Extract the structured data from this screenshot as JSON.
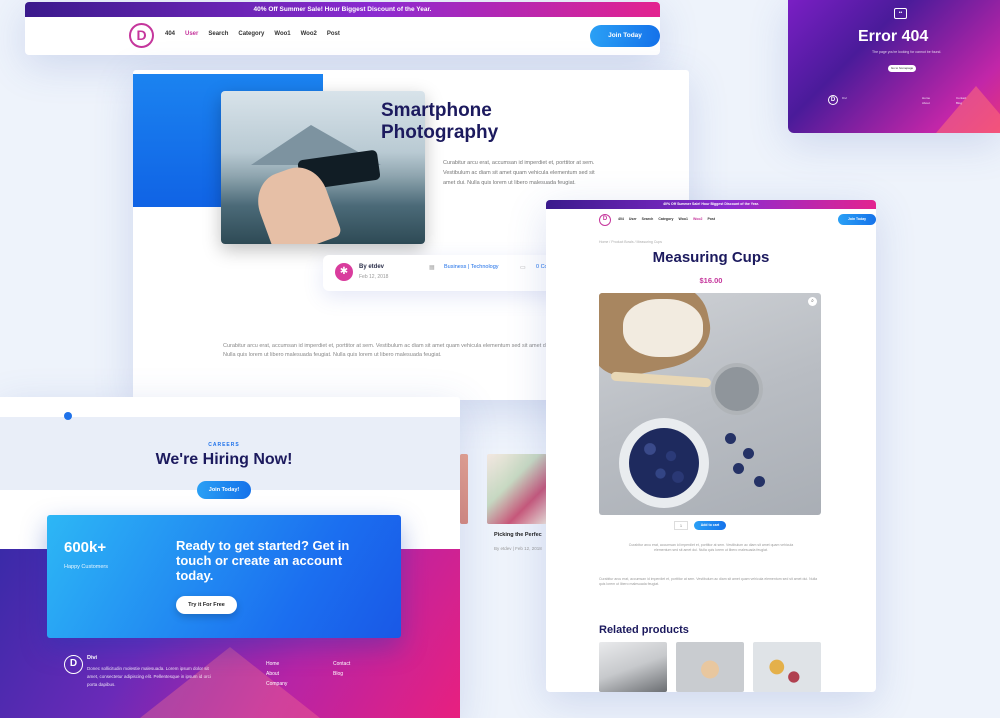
{
  "header": {
    "promo": "40% Off Summer Sale! Hour Biggest Discount of the Year.",
    "logo_letter": "D",
    "nav": [
      "404",
      "User",
      "Search",
      "Category",
      "Woo1",
      "Woo2",
      "Post"
    ],
    "active_nav": "User",
    "join_button": "Join Today",
    "accent_color": "#c5369c"
  },
  "error_page": {
    "title": "Error 404",
    "subtitle": "The page you're looking for cannot be found.",
    "button": "Go to homepage",
    "footer_brand": "Divi",
    "footer_links_1": [
      "Home",
      "About"
    ],
    "footer_links_2": [
      "Contact",
      "Blog"
    ]
  },
  "blog_post": {
    "title": "Smartphone Photography",
    "intro": "Curabitur arcu erat, accumsan id imperdiet et, porttitor at sem. Vestibulum ac diam sit amet quam vehicula elementum sed sit amet dui. Nulla quis lorem ut libero malesuada feugiat.",
    "author": "By etdev",
    "date": "Feb 12, 2018",
    "category": "Business | Technology",
    "comments": "0 Co",
    "body": "Curabitur arcu erat, accumsan id imperdiet et, porttitor at sem. Vestibulum ac diam sit amet quam vehicula elementum sed sit amet dui. Nulla quis lorem ut libero malesuada feugiat. Nulla quis lorem ut libero malesuada feugiat."
  },
  "careers": {
    "eyebrow": "CAREERS",
    "title": "We're Hiring Now!",
    "button": "Join Today!",
    "stat_value": "600k+",
    "stat_label": "Happy Customers",
    "cta_text": "Ready to get started? Get in touch or create an account today.",
    "cta_button": "Try it For Free",
    "footer_brand": "Divi",
    "footer_text": "Donec sollicitudin molestie malesuada. Lorem ipsum dolor sit amet, consectetur adipiscing elit. Pellentesque in ipsum id orci porta dapibus.",
    "footer_links_1": [
      "Home",
      "About",
      "Company"
    ],
    "footer_links_2": [
      "Contact",
      "Blog"
    ]
  },
  "related_post": {
    "title": "Picking the Perfec",
    "meta": "By etdev | Feb 12, 2018"
  },
  "product": {
    "promo": "40% Off Summer Sale! Hour Biggest Discount of the Year.",
    "logo_letter": "D",
    "nav": [
      "404",
      "User",
      "Search",
      "Category",
      "Woo1",
      "Woo2",
      "Post"
    ],
    "join_button": "Join Today",
    "breadcrumb": "Home / Product Bowls / Measuring Cups",
    "title": "Measuring Cups",
    "price": "$16.00",
    "zoom_icon": "magnifier-icon",
    "quantity": "1",
    "add_button": "Add to cart",
    "short_desc": "Curabitur arcu erat, accumsan id imperdiet et, porttitor at sem. Vestibulum ac diam sit amet quam vehicula elementum sed sit amet dui. Nulla quis lorem ut libero malesuada feugiat.",
    "long_desc": "Curabitur arcu erat, accumsan id imperdiet et, porttitor at sem. Vestibulum ac diam sit amet quam vehicula elementum sed sit amet dui. Nulla quis lorem ut libero malesuada feugiat.",
    "related_heading": "Related products"
  }
}
